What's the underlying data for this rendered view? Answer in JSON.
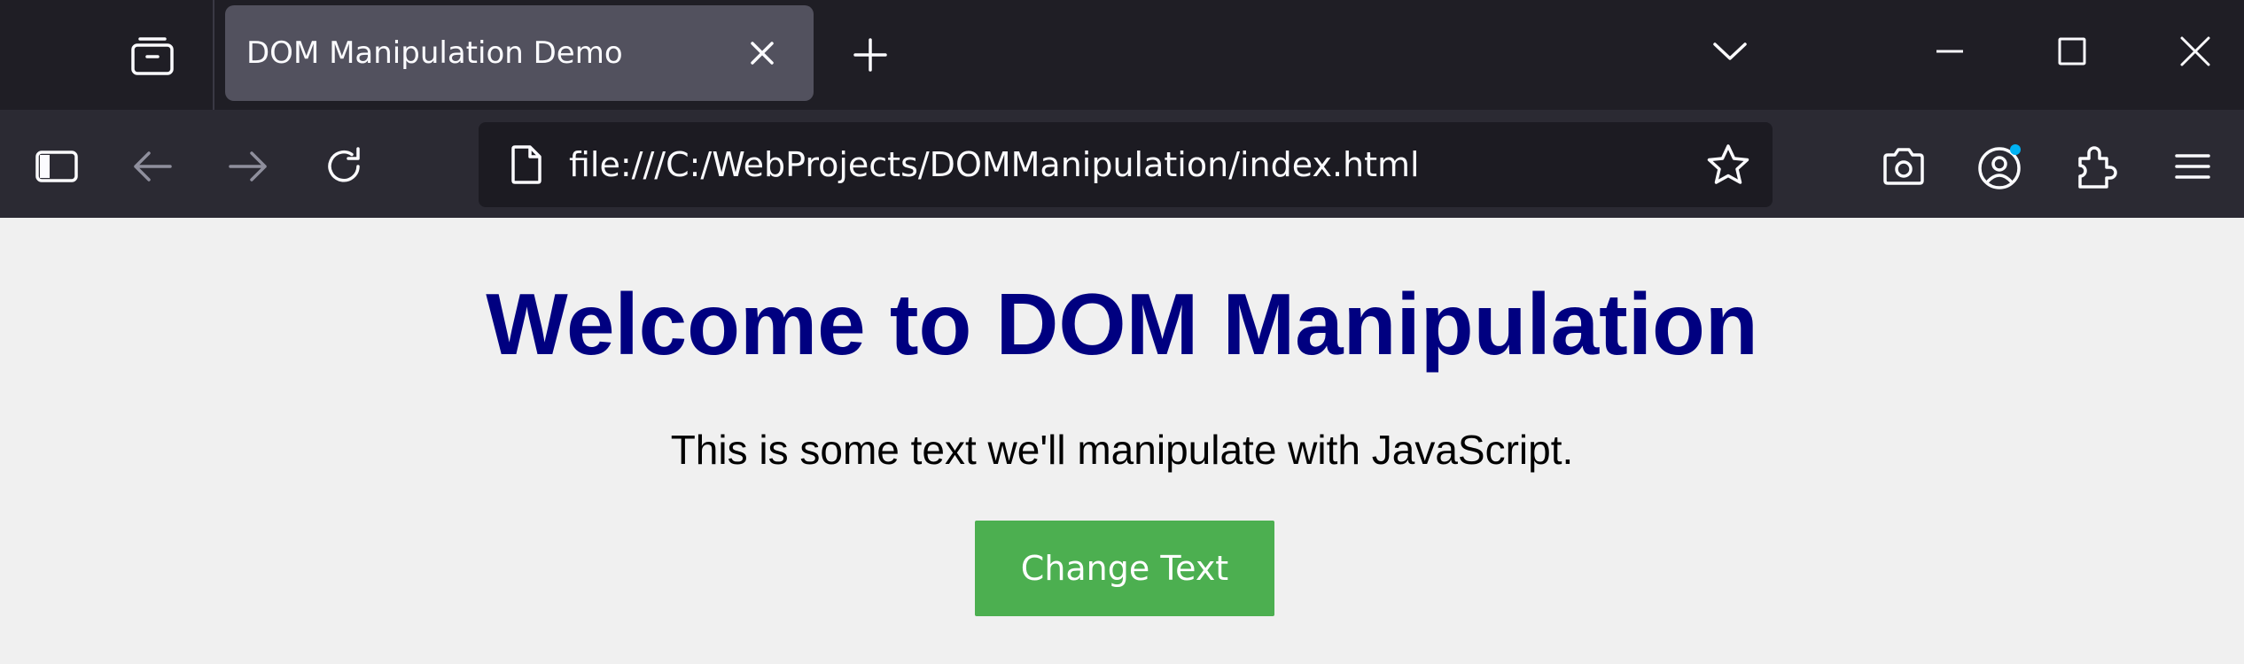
{
  "browser": {
    "tab": {
      "title": "DOM Manipulation Demo"
    },
    "urlbar": {
      "url": "file:///C:/WebProjects/DOMManipulation/index.html"
    },
    "colors": {
      "tabstrip_bg": "#1f1e25",
      "active_tab_bg": "#52515e",
      "toolbar_bg": "#2b2a33",
      "urlbar_bg": "#1c1b22",
      "account_badge": "#00b3f4"
    },
    "icons": {
      "tab_overview": "tab-overview-icon",
      "tab_close": "close-icon",
      "new_tab": "plus-icon",
      "tab_list": "chevron-down-icon",
      "window_minimize": "minimize-icon",
      "window_maximize": "maximize-icon",
      "window_close": "close-icon",
      "sidebar": "sidebar-icon",
      "back": "back-arrow-icon",
      "forward": "forward-arrow-icon",
      "reload": "reload-icon",
      "page": "page-icon",
      "bookmark": "star-icon",
      "screenshot": "camera-icon",
      "account": "account-icon",
      "extensions": "puzzle-icon",
      "menu": "hamburger-menu-icon"
    }
  },
  "page": {
    "heading": "Welcome to DOM Manipulation",
    "paragraph": "This is some text we'll manipulate with JavaScript.",
    "button_label": "Change Text",
    "colors": {
      "heading": "#000080",
      "button_bg": "#4caf50",
      "button_text": "#ffffff",
      "background": "#f0f0f0"
    }
  }
}
